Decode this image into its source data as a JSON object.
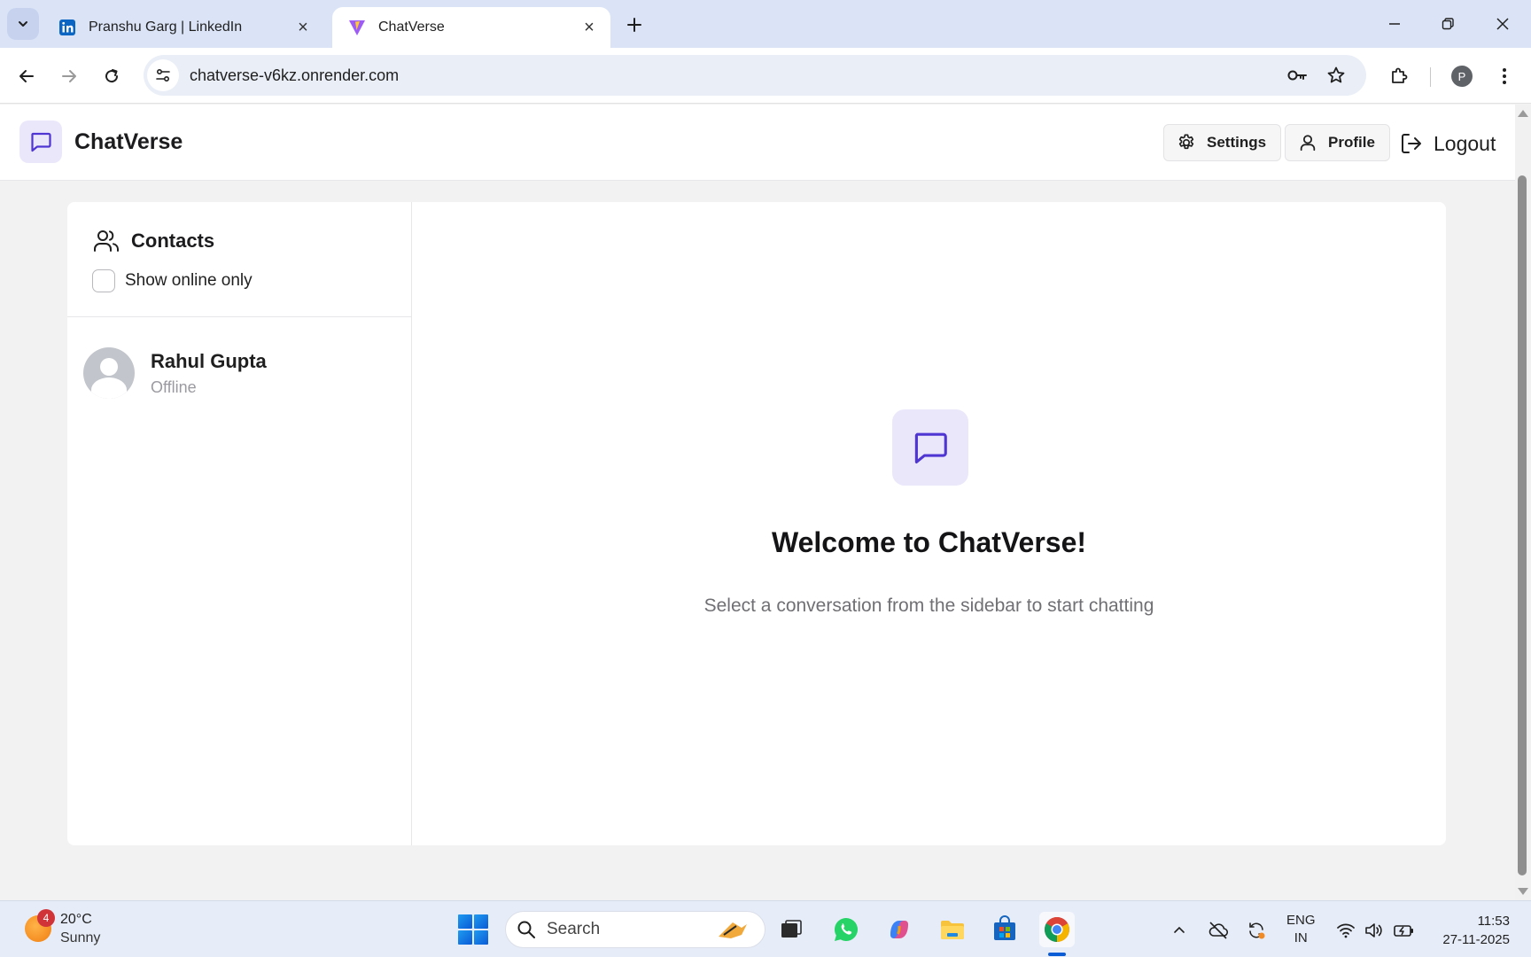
{
  "browser": {
    "tabs": [
      {
        "title": "Pranshu Garg | LinkedIn",
        "active": false,
        "favicon": "linkedin-icon"
      },
      {
        "title": "ChatVerse",
        "active": true,
        "favicon": "vite-icon"
      }
    ],
    "url": "chatverse-v6kz.onrender.com",
    "profile_initial": "P"
  },
  "app": {
    "brand": "ChatVerse",
    "accent_color": "#4f35d2",
    "header": {
      "settings_label": "Settings",
      "profile_label": "Profile",
      "logout_label": "Logout"
    },
    "sidebar": {
      "title": "Contacts",
      "online_filter_label": "Show online only",
      "online_filter_checked": false,
      "contacts": [
        {
          "name": "Rahul Gupta",
          "status": "Offline"
        }
      ]
    },
    "welcome": {
      "title": "Welcome to ChatVerse!",
      "subtitle": "Select a conversation from the sidebar to start chatting"
    }
  },
  "taskbar": {
    "weather_badge": "4",
    "temperature": "20°C",
    "condition": "Sunny",
    "search_placeholder": "Search",
    "lang_line1": "ENG",
    "lang_line2": "IN",
    "time": "11:53",
    "date": "27-11-2025"
  }
}
